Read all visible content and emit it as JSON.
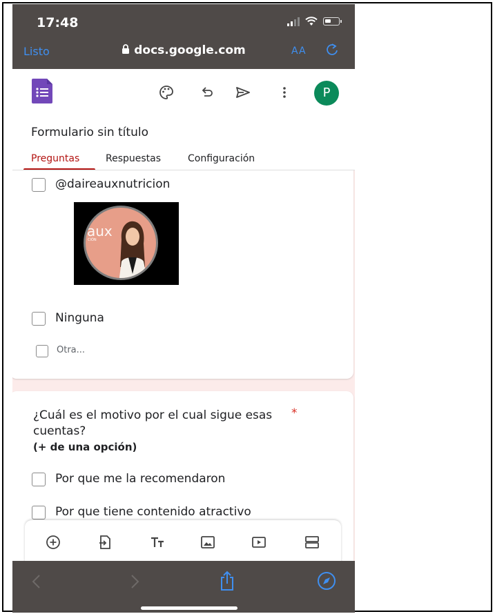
{
  "status": {
    "time": "17:48"
  },
  "browser": {
    "done_label": "Listo",
    "url": "docs.google.com",
    "text_size_label": "AA"
  },
  "form": {
    "title": "Formulario sin título",
    "avatar_letter": "P",
    "tabs": [
      {
        "label": "Preguntas",
        "active": true
      },
      {
        "label": "Respuestas",
        "active": false
      },
      {
        "label": "Configuración",
        "active": false
      }
    ]
  },
  "question1": {
    "options": [
      {
        "label": "@daireauxnutricion"
      },
      {
        "label": "Ninguna"
      }
    ],
    "other_label": "Otra...",
    "image_text": "aux",
    "image_subtext": "CIÓN"
  },
  "question2": {
    "title": "¿Cuál es el motivo por el cual sigue esas cuentas?",
    "required_mark": "*",
    "subtitle": "(+ de una opción)",
    "options": [
      {
        "label": "Por que me la recomendaron"
      },
      {
        "label": "Por que tiene contenido atractivo"
      }
    ]
  },
  "colors": {
    "accent": "#b31412",
    "brand_purple": "#7248b9",
    "avatar": "#0b8a5a",
    "safari_blue": "#3f8ff0",
    "bar": "#4f4a48"
  }
}
